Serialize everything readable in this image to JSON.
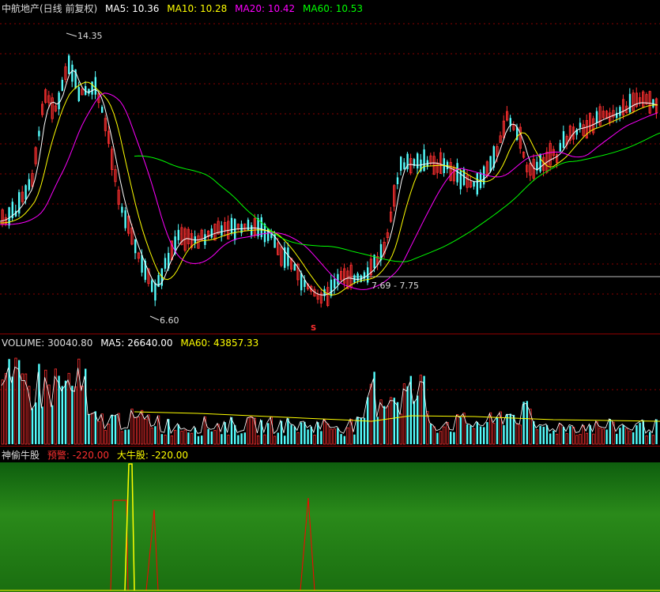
{
  "header": {
    "stock_name": "中航地产(日线 前复权)",
    "ma5": "MA5: 10.36",
    "ma10": "MA10: 10.28",
    "ma20": "MA20: 10.42",
    "ma60": "MA60: 10.53"
  },
  "annotations": {
    "high": "14.35",
    "low": "6.60",
    "range": "7.69 - 7.75",
    "signal": "S"
  },
  "volume": {
    "label": "VOLUME: 30040.80",
    "ma5": "MA5: 26640.00",
    "ma60": "MA60: 43857.33"
  },
  "indicator": {
    "name": "神偷牛股",
    "warning": "预警: -220.00",
    "bull": "大牛股: -220.00"
  },
  "colors": {
    "up": "#ff3030",
    "down": "#54fcfc",
    "ma5": "#ffffff",
    "ma10": "#ffff00",
    "ma20": "#ff00ff",
    "ma60": "#00ff00",
    "warning": "#ff0000",
    "bull": "#ffff00"
  }
}
